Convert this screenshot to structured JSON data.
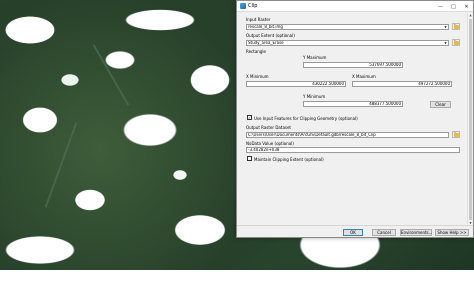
{
  "window": {
    "title": "Clip"
  },
  "form": {
    "input_raster": {
      "label": "Input Raster",
      "value": "rescale_8_bit.img"
    },
    "output_extent": {
      "label": "Output Extent (optional)",
      "value": "Study_area_Erase"
    },
    "rectangle": {
      "label": "Rectangle",
      "y_max_label": "Y Maximum",
      "y_max": "537697.500000",
      "x_min_label": "X Minimum",
      "x_min": "430222.500000",
      "x_max_label": "X Maximum",
      "x_max": "497272.500000",
      "y_min_label": "Y Minimum",
      "y_min": "488377.500000",
      "clear_label": "Clear"
    },
    "use_input_features": {
      "label": "Use Input Features for Clipping Geometry (optional)",
      "checked": true
    },
    "output_raster": {
      "label": "Output Raster Dataset",
      "value": "C:\\Users\\User\\Documents\\ArcGIS\\Default.gdb\\rescale_8_bit_Clip"
    },
    "nodata": {
      "label": "NoData Value (optional)",
      "value": "-3.40282e+038"
    },
    "maintain_extent": {
      "label": "Maintain Clipping Extent (optional)",
      "checked": false
    }
  },
  "buttons": {
    "ok": "OK",
    "cancel": "Cancel",
    "environments": "Environments...",
    "show_help": "Show Help >>"
  },
  "icons": {
    "window": "clip-tool-icon",
    "minimize": "minimize-icon",
    "maximize": "maximize-icon",
    "close": "close-icon",
    "folder": "folder-icon",
    "dropdown": "chevron-down-icon"
  }
}
